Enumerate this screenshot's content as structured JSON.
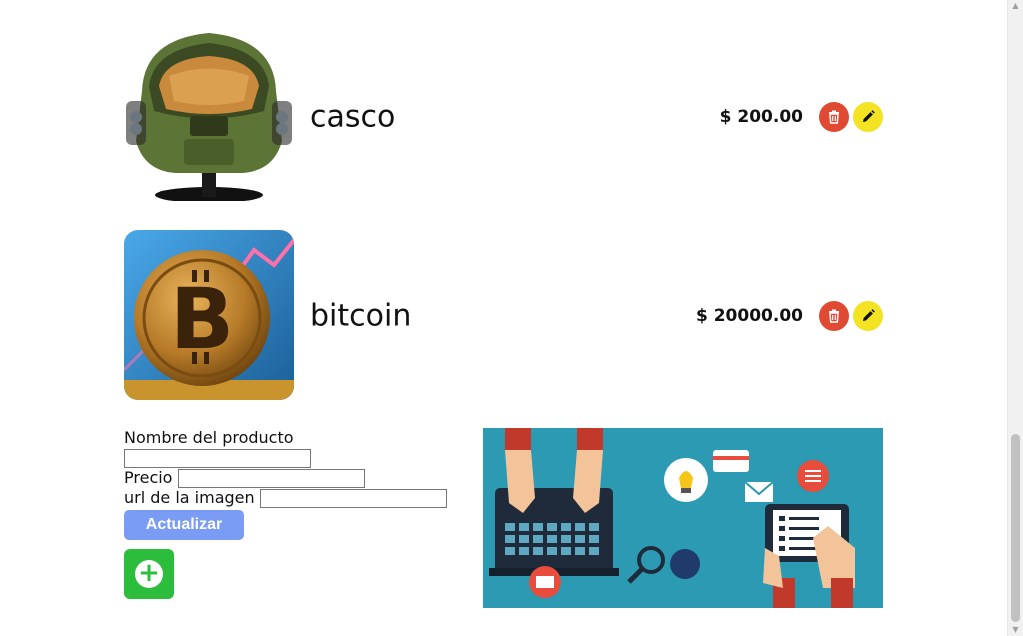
{
  "products": [
    {
      "name": "casco",
      "price": "$ 200.00",
      "image": "master-chief-helmet"
    },
    {
      "name": "bitcoin",
      "price": "$ 20000.00",
      "image": "bitcoin-coin"
    }
  ],
  "form": {
    "name_label": "Nombre del producto",
    "name_value": "",
    "price_label": "Precio",
    "price_value": "",
    "url_label": "url de la imagen",
    "url_value": "",
    "update_button": "Actualizar"
  },
  "icons": {
    "delete": "trash-icon",
    "edit": "pencil-icon",
    "add": "plus-icon"
  },
  "colors": {
    "delete": "#e04a32",
    "edit": "#f4e322",
    "update": "#7a9cf5",
    "add": "#2dbd3c",
    "banner_bg": "#2d9ab3"
  }
}
